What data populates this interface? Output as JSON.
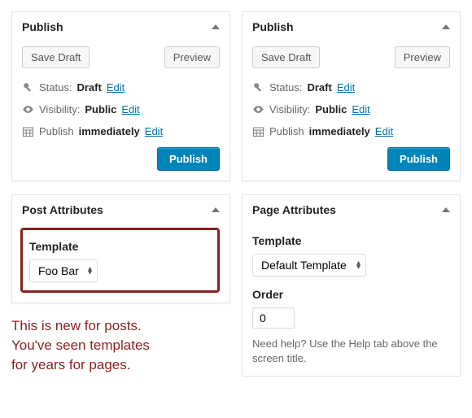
{
  "left": {
    "publish": {
      "title": "Publish",
      "save_draft": "Save Draft",
      "preview": "Preview",
      "status_label": "Status:",
      "status_value": "Draft",
      "visibility_label": "Visibility:",
      "visibility_value": "Public",
      "schedule_label": "Publish",
      "schedule_value": "immediately",
      "edit": "Edit",
      "publish_btn": "Publish"
    },
    "attributes": {
      "title": "Post Attributes",
      "template_label": "Template",
      "template_value": "Foo Bar"
    },
    "annotation": {
      "line1": "This is new for posts.",
      "line2": "You've seen templates",
      "line3": "for years for pages."
    }
  },
  "right": {
    "publish": {
      "title": "Publish",
      "save_draft": "Save Draft",
      "preview": "Preview",
      "status_label": "Status:",
      "status_value": "Draft",
      "visibility_label": "Visibility:",
      "visibility_value": "Public",
      "schedule_label": "Publish",
      "schedule_value": "immediately",
      "edit": "Edit",
      "publish_btn": "Publish"
    },
    "attributes": {
      "title": "Page Attributes",
      "template_label": "Template",
      "template_value": "Default Template",
      "order_label": "Order",
      "order_value": "0",
      "help_text": "Need help? Use the Help tab above the screen title."
    }
  }
}
